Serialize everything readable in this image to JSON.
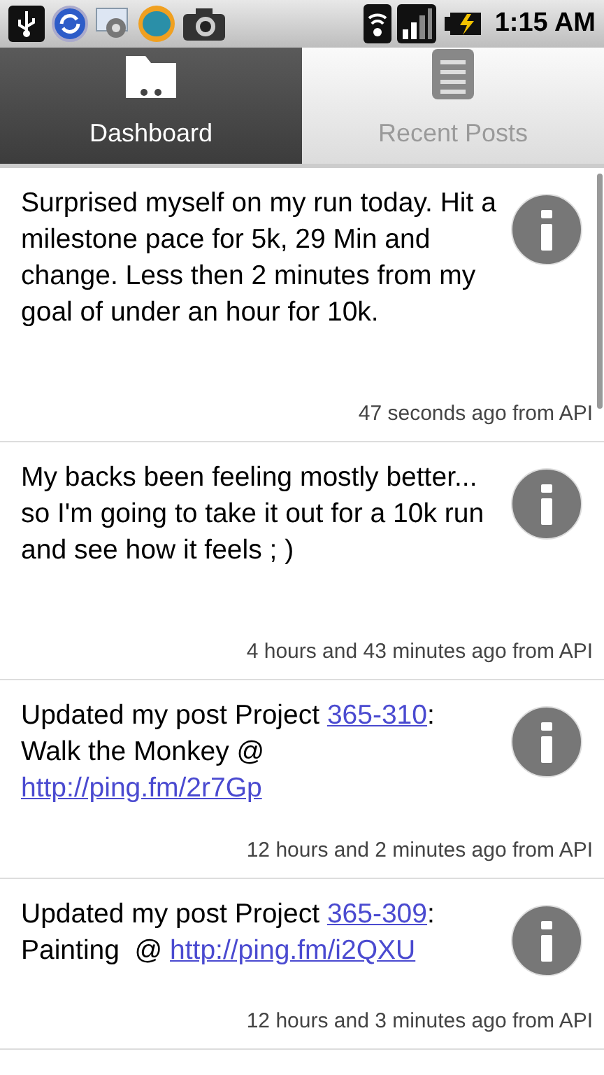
{
  "status_bar": {
    "time": "1:15 AM"
  },
  "tabs": [
    {
      "label": "Dashboard",
      "selected": true,
      "kind": "folder"
    },
    {
      "label": "Recent Posts",
      "selected": false,
      "kind": "list"
    }
  ],
  "posts": [
    {
      "body": [
        {
          "kind": "text",
          "text": "Surprised myself on my run today. Hit a milestone pace for 5k, 29 Min and change. Less then 2 minutes from my goal of under an hour for 10k."
        }
      ],
      "meta": "47 seconds ago from API"
    },
    {
      "body": [
        {
          "kind": "text",
          "text": "My backs been feeling mostly better... so I'm going to take it out for a 10k run and see how it feels ; )"
        }
      ],
      "meta": "4 hours and 43 minutes ago from API"
    },
    {
      "body": [
        {
          "kind": "text",
          "text": "Updated my post Project "
        },
        {
          "kind": "link",
          "text": "365-310"
        },
        {
          "kind": "text",
          "text": ": Walk the Monkey @ "
        },
        {
          "kind": "link",
          "text": "http://ping.fm/2r7Gp"
        }
      ],
      "meta": "12 hours and 2 minutes ago from API"
    },
    {
      "body": [
        {
          "kind": "text",
          "text": "Updated my post Project "
        },
        {
          "kind": "link",
          "text": "365-309"
        },
        {
          "kind": "text",
          "text": ": Painting  @ "
        },
        {
          "kind": "link",
          "text": "http://ping.fm/i2QXU"
        }
      ],
      "meta": "12 hours and 3 minutes ago from API"
    }
  ]
}
